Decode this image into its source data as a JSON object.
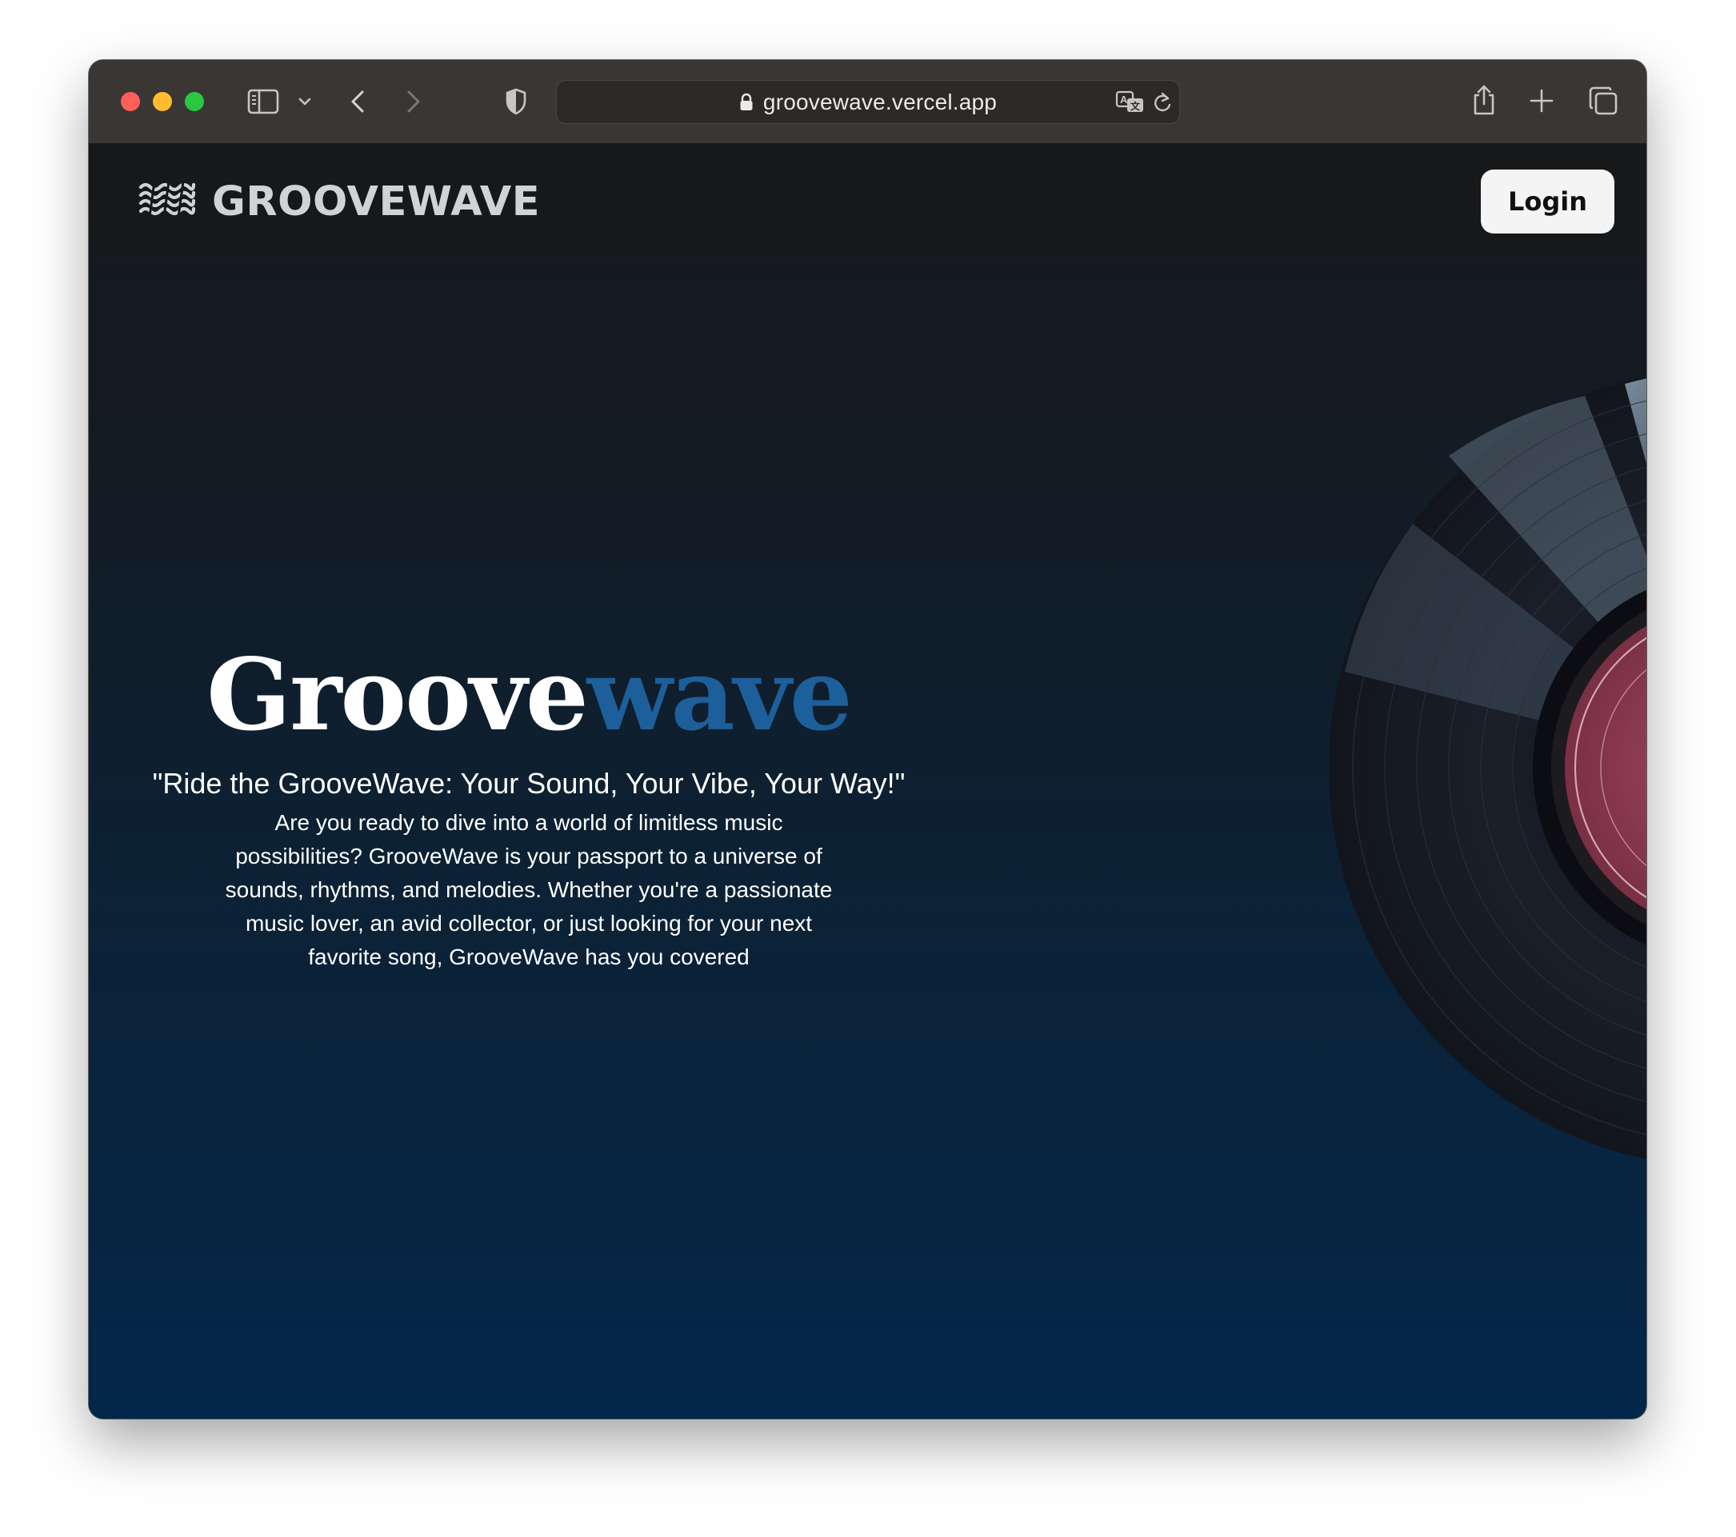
{
  "browser": {
    "url": "groovewave.vercel.app",
    "icons": {
      "sidebar": "sidebar-icon",
      "sidebar_menu": "chevron-down-icon",
      "back": "chevron-left-icon",
      "forward": "chevron-right-icon",
      "privacy": "shield-icon",
      "lock": "lock-icon",
      "translate": "translate-icon",
      "reload": "reload-icon",
      "share": "share-icon",
      "new_tab": "plus-icon",
      "tabs": "tabs-overview-icon"
    }
  },
  "header": {
    "brand": "GROOVEWAVE",
    "logo_icon": "waves-icon",
    "login_label": "Login"
  },
  "hero": {
    "title_main": "Groove",
    "title_accent": "wave",
    "tagline": "\"Ride the GrooveWave: Your Sound, Your Vibe, Your Way!\"",
    "description": "Are you ready to dive into a world of limitless music possibilities? GrooveWave is your passport to a universe of sounds, rhythms, and melodies. Whether you're a passionate music lover, an avid collector, or just looking for your next favorite song, GrooveWave has you covered"
  },
  "colors": {
    "accent": "#1d5f9a",
    "background_top": "#171819",
    "background_bottom": "#03274a",
    "login_bg": "#f4f4f5",
    "vinyl_label": "#8c3a52"
  }
}
